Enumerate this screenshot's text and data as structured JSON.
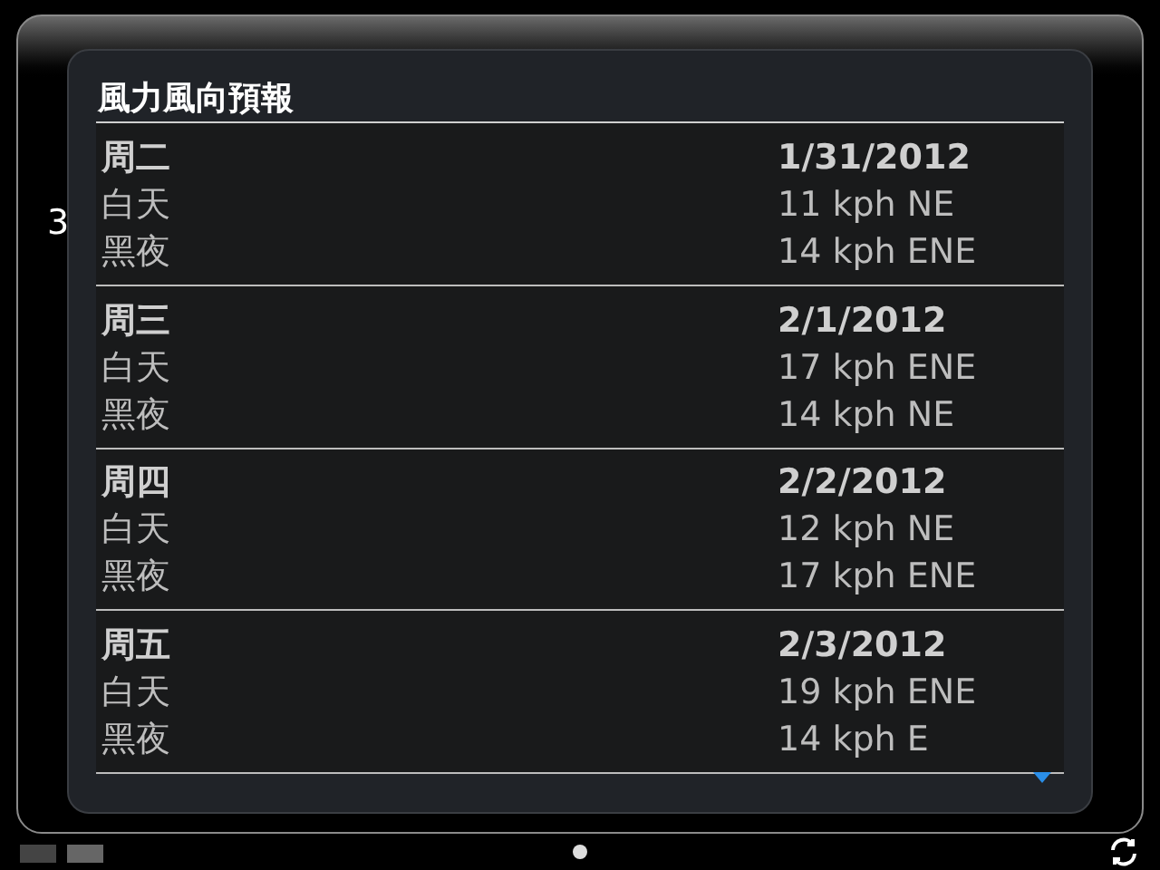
{
  "background": {
    "label": "3"
  },
  "dialog": {
    "title": "風力風向預報",
    "days": [
      {
        "day": "周二",
        "date": "1/31/2012",
        "periods": [
          {
            "label": "白天",
            "wind": "11 kph NE"
          },
          {
            "label": "黑夜",
            "wind": "14 kph ENE"
          }
        ]
      },
      {
        "day": "周三",
        "date": "2/1/2012",
        "periods": [
          {
            "label": "白天",
            "wind": "17 kph ENE"
          },
          {
            "label": "黑夜",
            "wind": "14 kph NE"
          }
        ]
      },
      {
        "day": "周四",
        "date": "2/2/2012",
        "periods": [
          {
            "label": "白天",
            "wind": "12 kph NE"
          },
          {
            "label": "黑夜",
            "wind": "17 kph ENE"
          }
        ]
      },
      {
        "day": "周五",
        "date": "2/3/2012",
        "periods": [
          {
            "label": "白天",
            "wind": "19 kph ENE"
          },
          {
            "label": "黑夜",
            "wind": "14 kph E"
          }
        ]
      }
    ]
  }
}
